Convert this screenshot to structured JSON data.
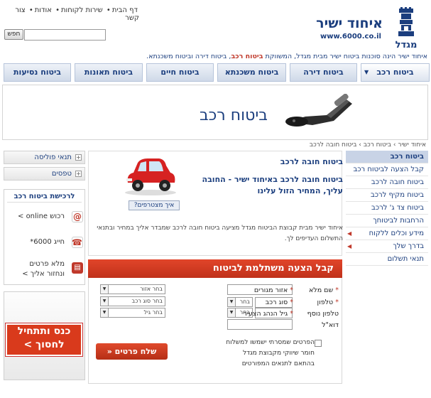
{
  "header": {
    "brand": "איחוד ישיר",
    "url": "www.6000.co.il",
    "logo_caption": "מגדל",
    "top_links": [
      "דף הבית",
      "שירות לקוחות",
      "אודות",
      "צור קשר"
    ],
    "search_button": "חפש",
    "search_placeholder": ""
  },
  "tagline": {
    "prefix": "איחוד ישיר הינה סוכנות ביטוח ישיר מבית מגדל, המשווקת",
    "bold": "ביטוח רכב",
    "suffix": ", ביטוח דירה וביטוח משכנתא."
  },
  "tabs": [
    "ביטוח רכב",
    "ביטוח דירה",
    "ביטוח משכנתא",
    "ביטוח חיים",
    "ביטוח תאונות",
    "ביטוח נסיעות"
  ],
  "banner": {
    "title": "ביטוח רכב"
  },
  "breadcrumb": "איחוד ישיר › ביטוח רכב › ביטוח חובה לרכב",
  "right_sidebar": [
    "ביטוח רכב",
    "קבל הצעה לביטוח רכב",
    "ביטוח חובה לרכב",
    "ביטוח מקיף לרכב",
    "ביטוח צד ג' לרכב",
    "הרחבות לביטוחך",
    "מידע וכלים ללקוח",
    "בדרך שלך",
    "תנאי תשלום"
  ],
  "left_sidebar": {
    "accordion": [
      "תנאי פוליסה",
      "טפסים"
    ],
    "buy_title": "לרכישת ביטוח רכב",
    "buy_online": "רכוש online >",
    "buy_phone": "חייג 6000*",
    "buy_form_line1": "מלא פרטים",
    "buy_form_line2": "ונחזור אליך >",
    "promo_line1": "כנס ותתחיל",
    "promo_line2": "לחסוך >"
  },
  "main": {
    "title": "ביטוח חובה לרכב",
    "subtitle": "ביטוח חובה לרכב באיחוד ישיר - החובה עליך, המחיר הזול עלינו",
    "how_button": "איך מצטרפים?",
    "description": "איחוד ישיר מבית קבוצת הביטוח מגדל מציעה ביטוח חובה לרכב שמבדר אליך במחיר ובתנאי התשלום העדיפים לך."
  },
  "form": {
    "header": "קבל הצעה משתלמת לביטוח",
    "labels": {
      "name": "שם מלא",
      "phone": "טלפון",
      "phone2": "טלפון נוסף",
      "email": "דוא\"ל",
      "area": "אזור מגורים",
      "car_type": "סוג רכב",
      "driver_age": "גיל הנהג הצעיר"
    },
    "prefix_select": "בחר",
    "area_select": "בחר אזור",
    "car_select": "בחר סוג רכב",
    "age_select": "בחר גיל",
    "consent": "הפרטים שמסרתי ישמשו למשלוח חומר שיווקי מקבוצת מגדל בהתאם לתנאים המפורטים",
    "submit": "שלח פרטים"
  },
  "colors": {
    "brand_blue": "#1b3e7e",
    "accent_red": "#d93a1c"
  }
}
